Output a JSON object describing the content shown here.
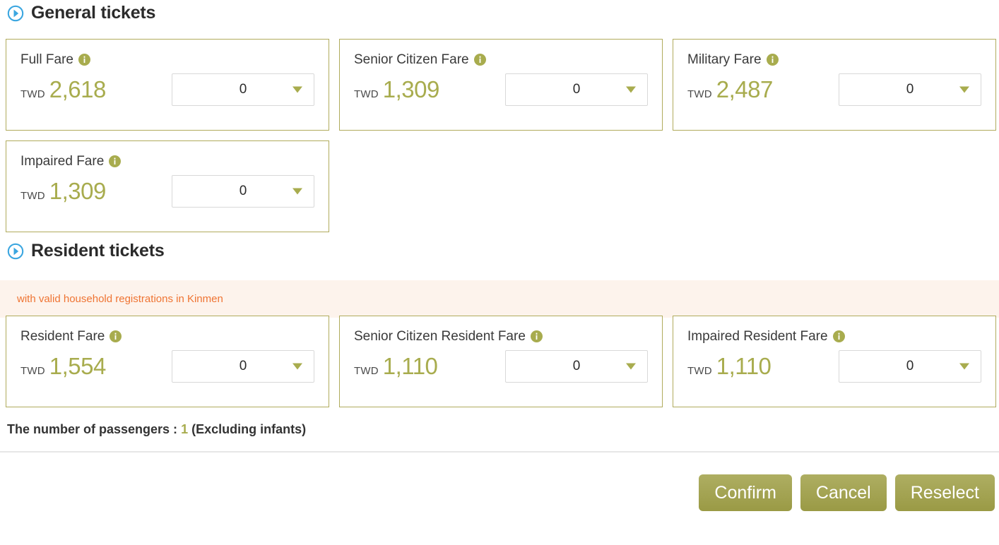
{
  "sections": [
    {
      "icon": "circle-arrow-right-icon",
      "title": "General tickets",
      "cards": [
        {
          "label": "Full Fare",
          "info_icon": "info-icon",
          "currency": "TWD",
          "amount": "2,618",
          "qty": "0"
        },
        {
          "label": "Senior Citizen Fare",
          "info_icon": "info-icon",
          "currency": "TWD",
          "amount": "1,309",
          "qty": "0"
        },
        {
          "label": "Military Fare",
          "info_icon": "info-icon",
          "currency": "TWD",
          "amount": "2,487",
          "qty": "0"
        },
        {
          "label": "Impaired Fare",
          "info_icon": "info-icon",
          "currency": "TWD",
          "amount": "1,309",
          "qty": "0"
        }
      ]
    },
    {
      "icon": "circle-arrow-right-icon",
      "title": "Resident tickets",
      "notice": "with valid household registrations in Kinmen",
      "cards": [
        {
          "label": "Resident Fare",
          "info_icon": "info-icon",
          "currency": "TWD",
          "amount": "1,554",
          "qty": "0"
        },
        {
          "label": "Senior Citizen Resident Fare",
          "info_icon": "info-icon",
          "currency": "TWD",
          "amount": "1,110",
          "qty": "0"
        },
        {
          "label": "Impaired Resident Fare",
          "info_icon": "info-icon",
          "currency": "TWD",
          "amount": "1,110",
          "qty": "0"
        }
      ]
    }
  ],
  "summary": {
    "prefix": "The number of passengers :",
    "count": "1",
    "suffix": "(Excluding infants)"
  },
  "actions": {
    "confirm": "Confirm",
    "cancel": "Cancel",
    "reselect": "Reselect"
  },
  "colors": {
    "accent_olive": "#a8ac4e",
    "card_border": "#b0ab5c",
    "notice_bg": "#fdf3ec",
    "notice_text": "#ef7433",
    "section_icon_blue": "#3ba6e0",
    "button_gradient_top": "#aeae62",
    "button_gradient_bottom": "#9a9a45"
  }
}
